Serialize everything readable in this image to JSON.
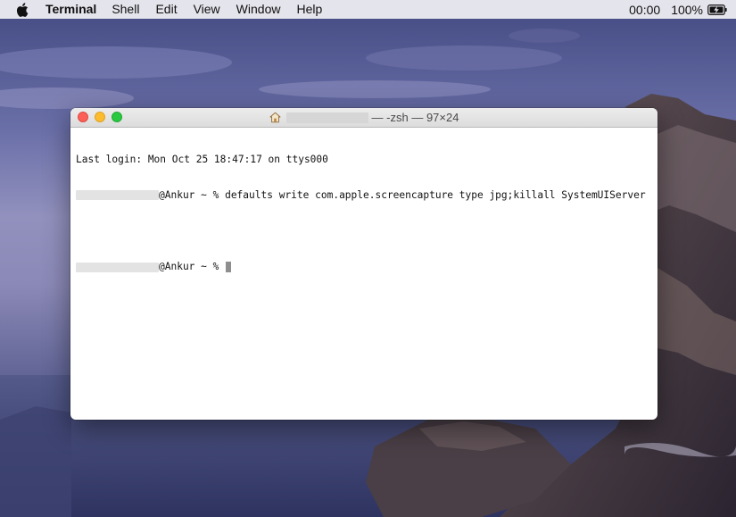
{
  "menubar": {
    "app_name": "Terminal",
    "items": [
      "Shell",
      "Edit",
      "View",
      "Window",
      "Help"
    ],
    "clock": "00:00",
    "battery_percent": "100%"
  },
  "window": {
    "title": "— -zsh — 97×24",
    "terminal": {
      "lines": [
        "Last login: Mon Oct 25 18:47:17 on ttys000",
        "@Ankur ~ % defaults write com.apple.screencapture type jpg;killall SystemUIServer",
        "",
        "@Ankur ~ % "
      ]
    }
  },
  "colors": {
    "close": "#fc5f57",
    "minimize": "#fdbc2e",
    "zoom": "#28c840",
    "menubar": "#e4e4ec"
  },
  "icons": [
    "apple-logo",
    "home-icon",
    "battery-charging-icon"
  ]
}
